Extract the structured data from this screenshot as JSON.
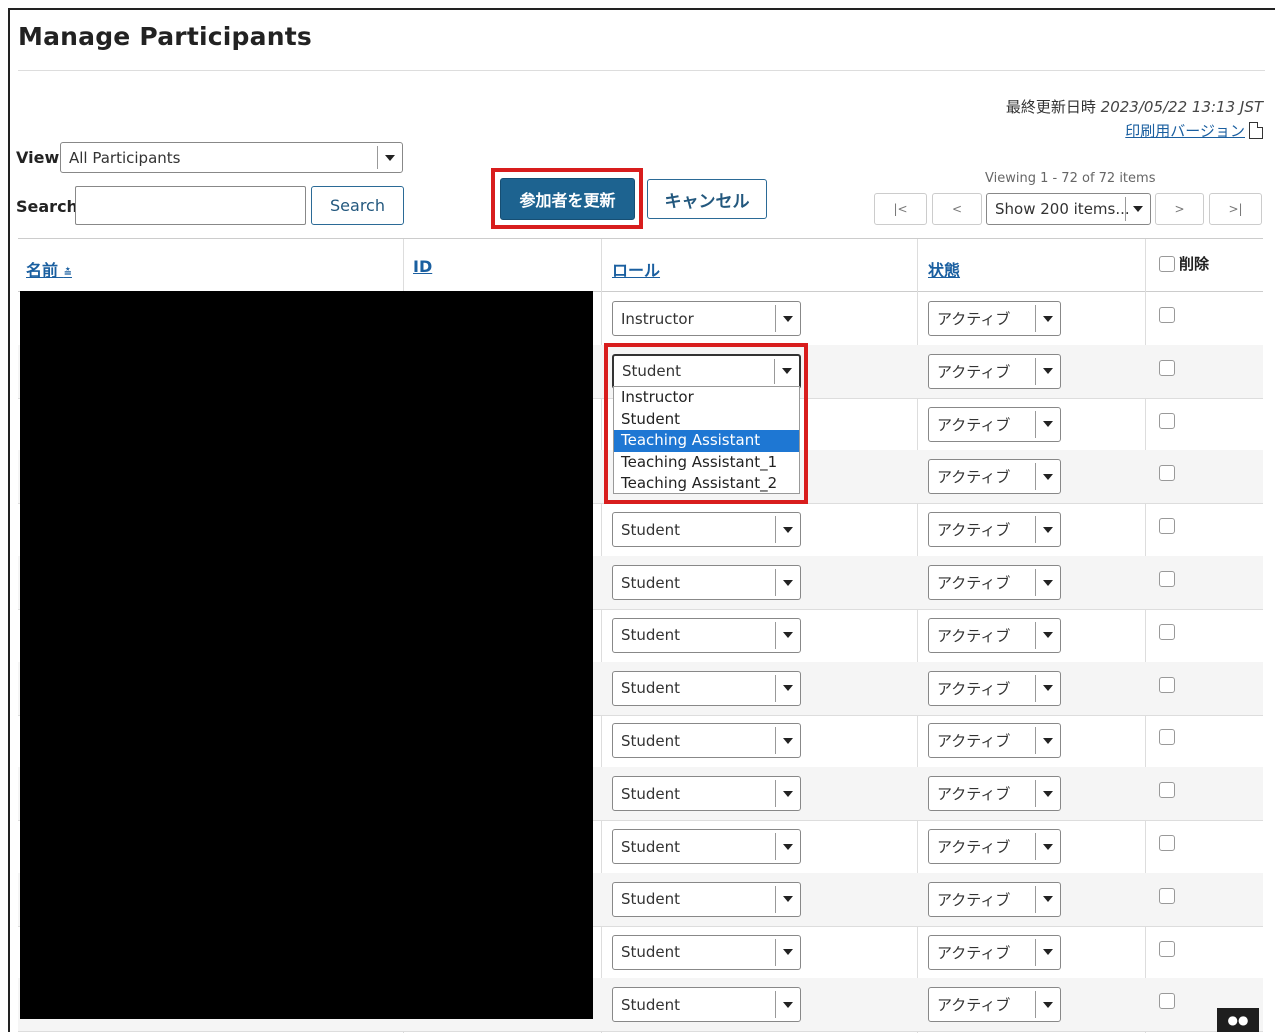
{
  "page": {
    "title": "Manage Participants"
  },
  "last_modified": {
    "label": "最終更新日時",
    "timestamp": "2023/05/22 13:13 JST"
  },
  "print_version": {
    "label": "印刷用バージョン",
    "icon": "pdf-icon"
  },
  "filters": {
    "view_label": "View",
    "view_value": "All Participants",
    "search_label": "Search",
    "search_value": "",
    "search_button": "Search"
  },
  "actions": {
    "update": "参加者を更新",
    "cancel": "キャンセル"
  },
  "pagination": {
    "viewing": "Viewing 1 - 72 of 72 items",
    "first": "|<",
    "prev": "<",
    "page_size": "Show 200 items...",
    "next": ">",
    "last": ">|"
  },
  "table": {
    "headers": {
      "name": "名前",
      "id": "ID",
      "role": "ロール",
      "status": "状態",
      "delete": "削除"
    },
    "rows": [
      {
        "role": "Instructor",
        "status": "アクティブ"
      },
      {
        "role": "Student",
        "status": "アクティブ"
      },
      {
        "role": "",
        "status": "アクティブ"
      },
      {
        "role": "",
        "status": "アクティブ"
      },
      {
        "role": "Student",
        "status": "アクティブ"
      },
      {
        "role": "Student",
        "status": "アクティブ"
      },
      {
        "role": "Student",
        "status": "アクティブ"
      },
      {
        "role": "Student",
        "status": "アクティブ"
      },
      {
        "role": "Student",
        "status": "アクティブ"
      },
      {
        "role": "Student",
        "status": "アクティブ"
      },
      {
        "role": "Student",
        "status": "アクティブ"
      },
      {
        "role": "Student",
        "status": "アクティブ"
      },
      {
        "role": "Student",
        "status": "アクティブ"
      },
      {
        "role": "Student",
        "status": "アクティブ"
      }
    ]
  },
  "role_dropdown": {
    "options": [
      "Instructor",
      "Student",
      "Teaching Assistant",
      "Teaching Assistant_1",
      "Teaching Assistant_2"
    ],
    "highlighted": "Teaching Assistant"
  },
  "colors": {
    "accent": "#1d6390",
    "link": "#1a5fa0",
    "highlight_box": "#d81d1d",
    "selected_option": "#1e77d3"
  }
}
